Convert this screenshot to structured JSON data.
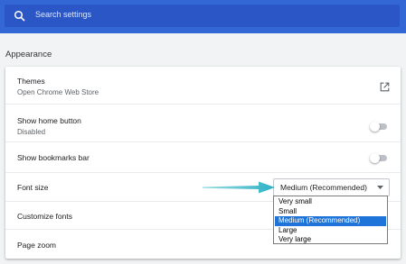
{
  "search": {
    "placeholder": "Search settings"
  },
  "section_title": "Appearance",
  "rows": {
    "themes": {
      "title": "Themes",
      "subtitle": "Open Chrome Web Store"
    },
    "home_button": {
      "title": "Show home button",
      "subtitle": "Disabled",
      "enabled": false
    },
    "bookmarks_bar": {
      "title": "Show bookmarks bar",
      "enabled": false
    },
    "font_size": {
      "title": "Font size",
      "selected": "Medium (Recommended)"
    },
    "customize_fonts": {
      "title": "Customize fonts"
    },
    "page_zoom": {
      "title": "Page zoom"
    }
  },
  "font_size_options": [
    "Very small",
    "Small",
    "Medium (Recommended)",
    "Large",
    "Very large"
  ],
  "colors": {
    "header": "#3367d6",
    "search_box": "#2a56c6",
    "highlight": "#1e74d8",
    "callout_arrow": "#35b6c9"
  },
  "icons": {
    "search": "search-icon",
    "external_link": "external-link-icon",
    "dropdown": "chevron-down-icon",
    "callout": "arrow-right-icon"
  }
}
